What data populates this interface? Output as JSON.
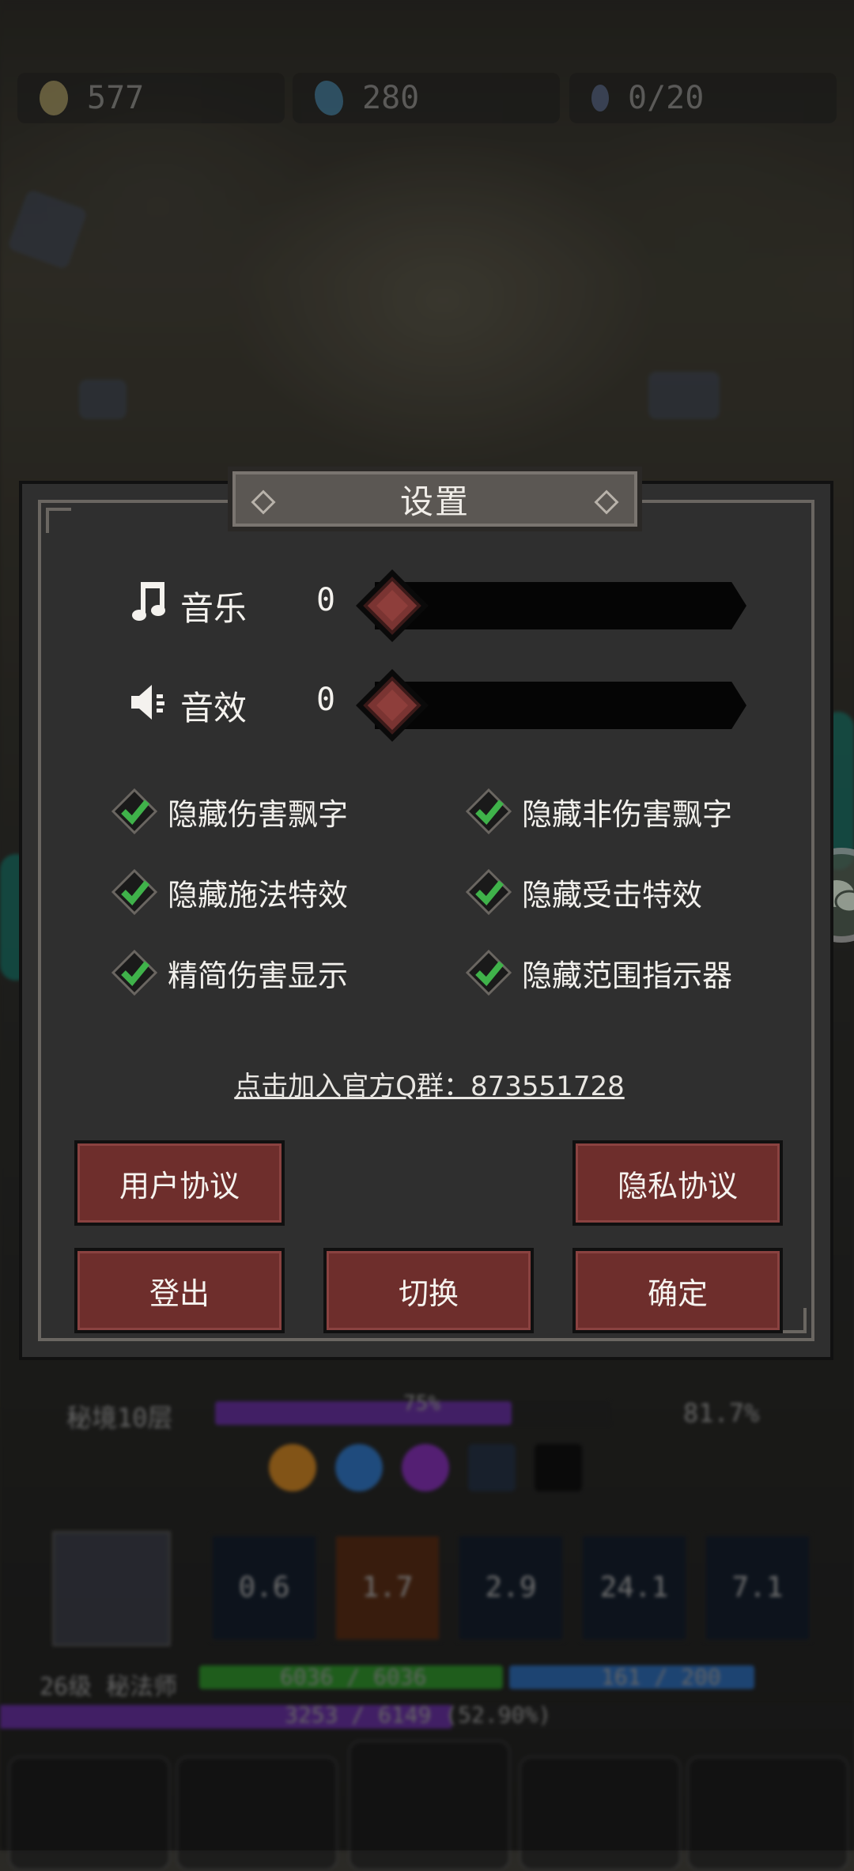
{
  "resources": [
    {
      "name": "gold",
      "value": "577",
      "color": "#d8c47a"
    },
    {
      "name": "gem",
      "value": "280",
      "color": "#4fa3d6"
    },
    {
      "name": "stamina",
      "value": "0/20",
      "color": "#6a7fb0"
    }
  ],
  "dialog": {
    "title": "设置",
    "music": {
      "label": "音乐",
      "value": "0",
      "level": 0
    },
    "sfx": {
      "label": "音效",
      "value": "0",
      "level": 0
    },
    "options": [
      {
        "label": "隐藏伤害飘字",
        "checked": true
      },
      {
        "label": "隐藏非伤害飘字",
        "checked": true
      },
      {
        "label": "隐藏施法特效",
        "checked": true
      },
      {
        "label": "隐藏受击特效",
        "checked": true
      },
      {
        "label": "精简伤害显示",
        "checked": true
      },
      {
        "label": "隐藏范围指示器",
        "checked": true
      }
    ],
    "qq_link": "点击加入官方Q群：873551728",
    "buttons": {
      "user_agreement": "用户协议",
      "privacy": "隐私协议",
      "logout": "登出",
      "switch": "切换",
      "confirm": "确定"
    }
  },
  "hud": {
    "floor": "秘境10层",
    "floor_progress": "75%",
    "power": "81.7%",
    "skills": [
      "0.6",
      "1.7",
      "2.9",
      "24.1",
      "7.1"
    ],
    "level_class": "26级 秘法师",
    "hp": "6036 / 6036",
    "mp": "161 / 200",
    "exp": "3253 / 6149 (52.90%)"
  },
  "colors": {
    "button_fill": "#6e2e2c",
    "knob_fill": "#7a3432",
    "check_green": "#3fb24a",
    "panel_bg": "#2f2f2f"
  }
}
